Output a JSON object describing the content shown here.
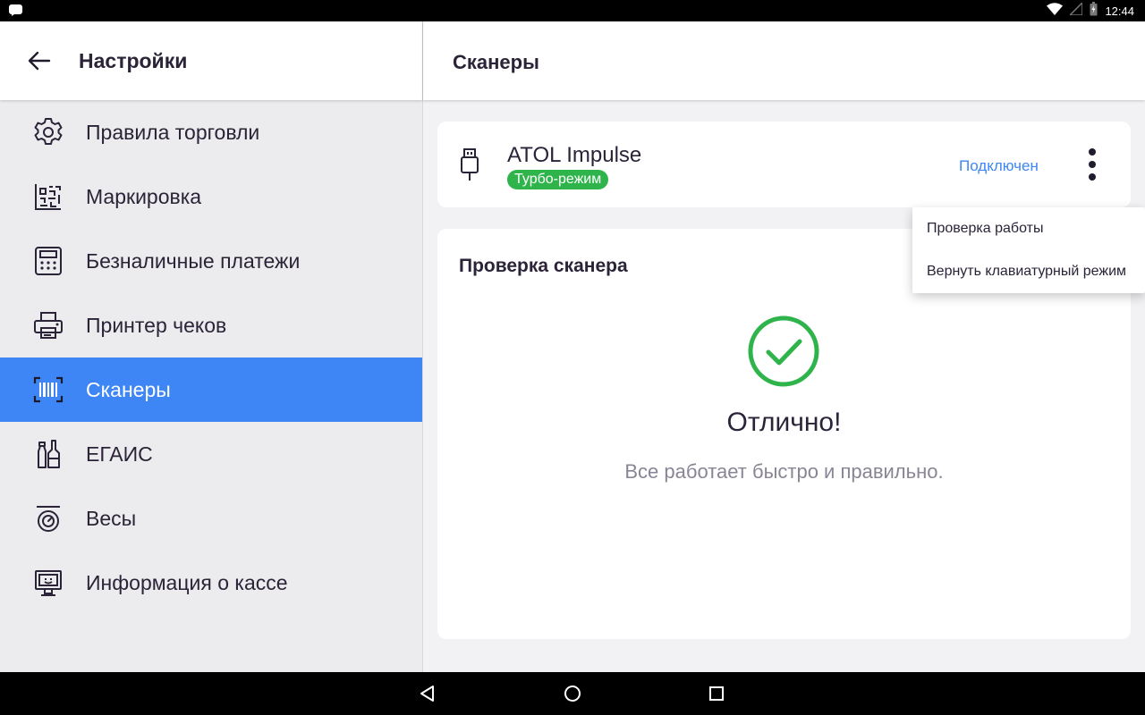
{
  "status_bar": {
    "time": "12:44",
    "icons": [
      "notification-icon",
      "wifi-icon",
      "battery-charging-icon"
    ]
  },
  "left_pane": {
    "title": "Настройки",
    "back_icon": "arrow-left-icon",
    "items": [
      {
        "label": "Правила торговли",
        "icon": "gear-icon",
        "active": false
      },
      {
        "label": "Маркировка",
        "icon": "datamatrix-icon",
        "active": false
      },
      {
        "label": "Безналичные платежи",
        "icon": "payment-terminal-icon",
        "active": false
      },
      {
        "label": "Принтер чеков",
        "icon": "printer-icon",
        "active": false
      },
      {
        "label": "Сканеры",
        "icon": "barcode-scanner-icon",
        "active": true
      },
      {
        "label": "ЕГАИС",
        "icon": "bottles-icon",
        "active": false
      },
      {
        "label": "Весы",
        "icon": "scale-icon",
        "active": false
      },
      {
        "label": "Информация о кассе",
        "icon": "monitor-icon",
        "active": false
      }
    ]
  },
  "right_pane": {
    "title": "Сканеры",
    "device": {
      "name": "ATOL Impulse",
      "badge": "Турбо-режим",
      "status": "Подключен",
      "icon": "usb-icon"
    },
    "check": {
      "title": "Проверка сканера",
      "result": "Отлично!",
      "description": "Все работает быстро и правильно.",
      "icon": "check-circle-icon"
    }
  },
  "popup_menu": {
    "items": [
      "Проверка работы",
      "Вернуть клавиатурный режим"
    ]
  },
  "colors": {
    "accent": "#3e86f5",
    "success": "#2fb44c",
    "text": "#2b2338"
  },
  "nav_bar": {
    "icons": [
      "back-triangle-icon",
      "home-circle-icon",
      "recents-square-icon"
    ]
  }
}
